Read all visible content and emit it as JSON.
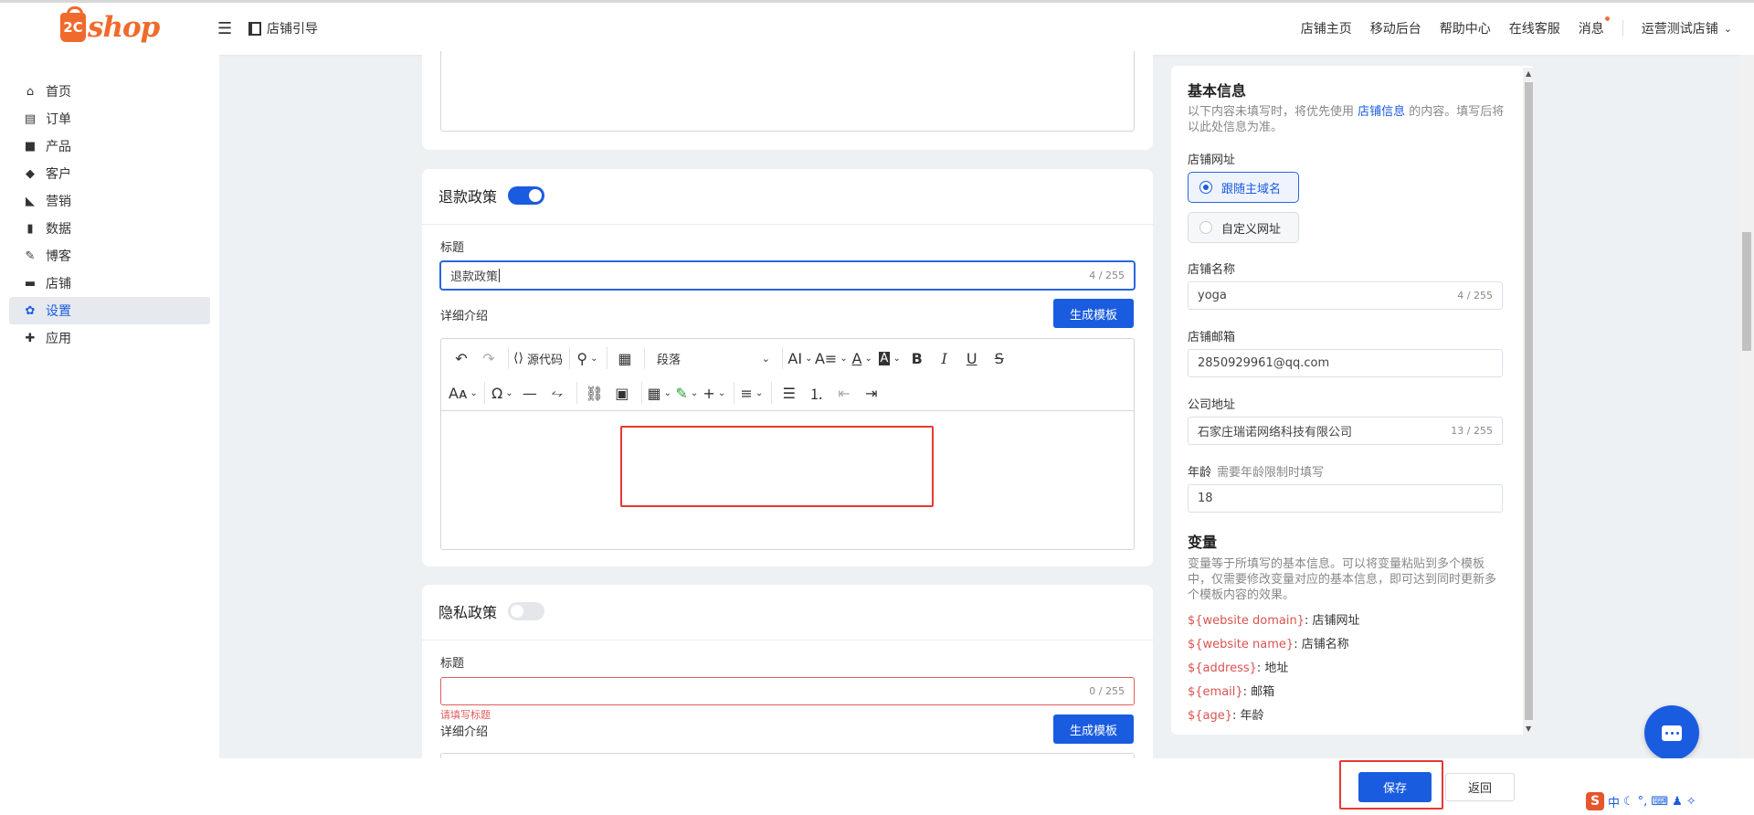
{
  "header": {
    "logo_badge": "2C",
    "logo_text": "shop",
    "menu_icon": "hamburger-icon",
    "store_guide": "店铺引导",
    "nav": [
      "店铺主页",
      "移动后台",
      "帮助中心",
      "在线客服",
      "消息"
    ],
    "store_select": "运营测试店铺"
  },
  "sidebar": {
    "items": [
      {
        "label": "首页",
        "icon": "home-icon"
      },
      {
        "label": "订单",
        "icon": "clipboard-icon"
      },
      {
        "label": "产品",
        "icon": "bag-icon"
      },
      {
        "label": "客户",
        "icon": "diamond-icon"
      },
      {
        "label": "营销",
        "icon": "tag-icon"
      },
      {
        "label": "数据",
        "icon": "bar-chart-icon"
      },
      {
        "label": "博客",
        "icon": "edit-icon"
      },
      {
        "label": "店铺",
        "icon": "store-icon"
      },
      {
        "label": "设置",
        "icon": "gear-icon"
      },
      {
        "label": "应用",
        "icon": "puzzle-icon"
      }
    ],
    "active": "设置"
  },
  "refund": {
    "title": "退款政策",
    "enabled": true,
    "title_label": "标题",
    "title_value": "退款政策",
    "title_count": "4 / 255",
    "detail_label": "详细介绍",
    "generate_btn": "生成模板",
    "source_code": "源代码",
    "paragraph": "段落"
  },
  "privacy": {
    "title": "隐私政策",
    "enabled": false,
    "title_label": "标题",
    "title_value": "",
    "title_count": "0 / 255",
    "error": "请填写标题",
    "detail_label": "详细介绍",
    "generate_btn": "生成模板"
  },
  "basic_info": {
    "heading": "基本信息",
    "desc_prefix": "以下内容未填写时，将优先使用 ",
    "desc_link": "店铺信息",
    "desc_suffix": " 的内容。填写后将以此处信息为准。",
    "url_label": "店铺网址",
    "url_options": [
      "跟随主域名",
      "自定义网址"
    ],
    "url_selected": "跟随主域名",
    "name_label": "店铺名称",
    "name_value": "yoga",
    "name_count": "4 / 255",
    "email_label": "店铺邮箱",
    "email_value": "2850929961@qq.com",
    "address_label": "公司地址",
    "address_value": "石家庄瑞诺网络科技有限公司",
    "address_count": "13 / 255",
    "age_label": "年龄",
    "age_hint": "需要年龄限制时填写",
    "age_value": "18"
  },
  "variables": {
    "heading": "变量",
    "desc": "变量等于所填写的基本信息。可以将变量粘贴到多个模板中，仅需要修改变量对应的基本信息，即可达到同时更新多个模板内容的效果。",
    "items": [
      {
        "var": "${website domain}",
        "meaning": ": 店铺网址"
      },
      {
        "var": "${website name}",
        "meaning": ": 店铺名称"
      },
      {
        "var": "${address}",
        "meaning": ": 地址"
      },
      {
        "var": "${email}",
        "meaning": ": 邮箱"
      },
      {
        "var": "${age}",
        "meaning": ": 年龄"
      }
    ]
  },
  "footer": {
    "save": "保存",
    "back": "返回"
  },
  "ime": {
    "logo": "S",
    "lang": "中"
  },
  "colors": {
    "primary": "#1a5ce0",
    "brand_orange": "#f06a2d",
    "error_red": "#e25b5b",
    "highlight_red": "#e53935"
  }
}
